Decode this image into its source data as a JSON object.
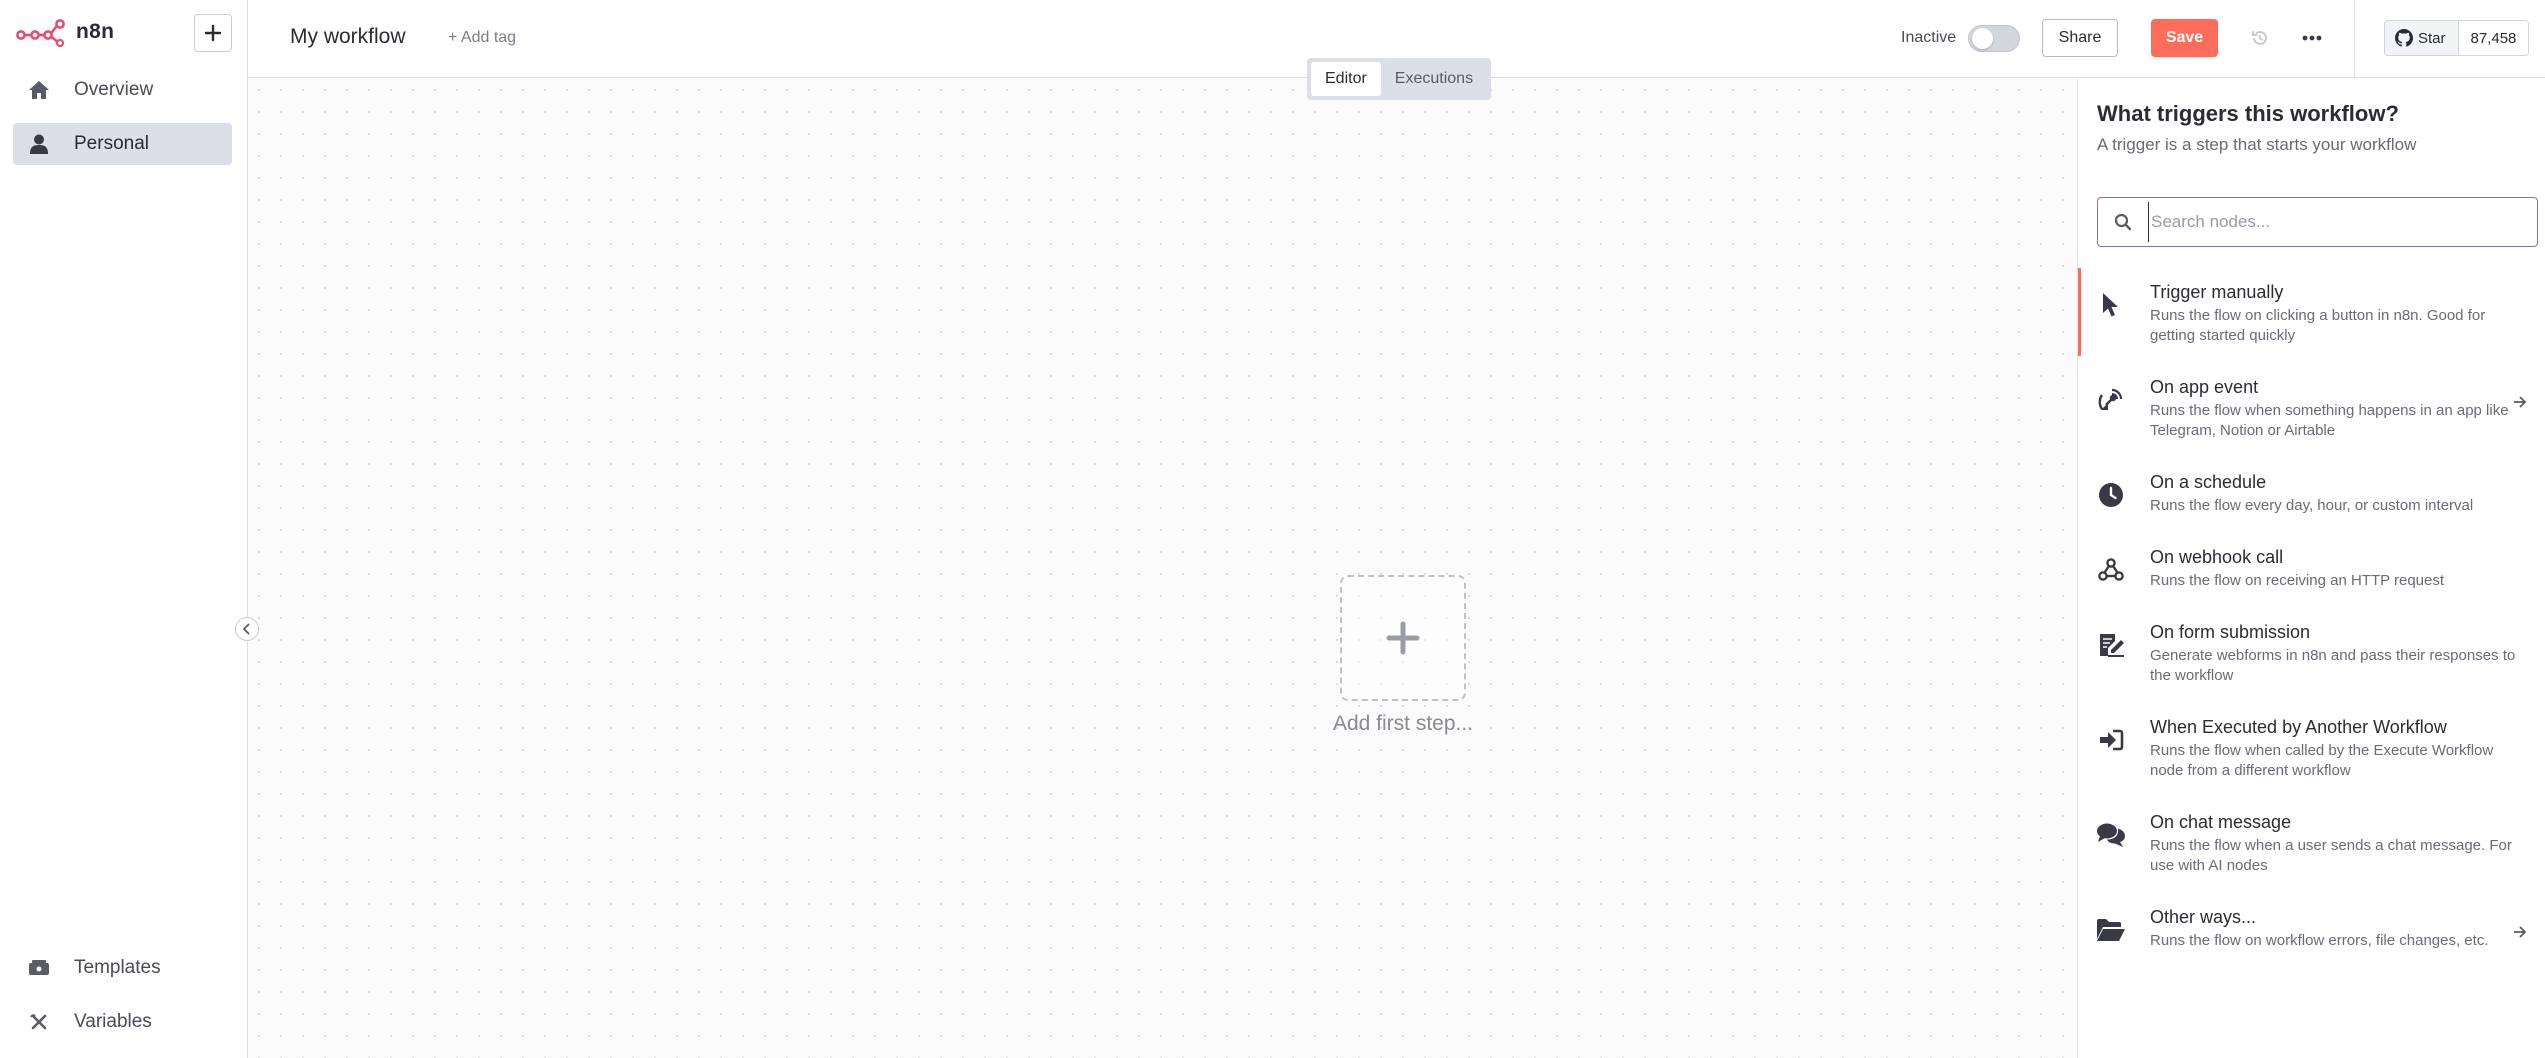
{
  "app": {
    "name": "n8n"
  },
  "sidebar": {
    "items": [
      {
        "label": "Overview",
        "icon": "home-icon",
        "active": false
      },
      {
        "label": "Personal",
        "icon": "user-icon",
        "active": true
      }
    ],
    "bottom_items": [
      {
        "label": "Templates",
        "icon": "templates-icon"
      },
      {
        "label": "Variables",
        "icon": "variables-icon"
      }
    ]
  },
  "header": {
    "workflow_name": "My workflow",
    "add_tag": "+ Add tag",
    "status": "Inactive",
    "share": "Share",
    "save": "Save",
    "github_star": "Star",
    "github_count": "87,458"
  },
  "canvas": {
    "tabs": [
      {
        "label": "Editor",
        "active": true
      },
      {
        "label": "Executions",
        "active": false
      }
    ],
    "add_first_step": "Add first step..."
  },
  "panel": {
    "title": "What triggers this workflow?",
    "subtitle": "A trigger is a step that starts your workflow",
    "search_placeholder": "Search nodes...",
    "triggers": [
      {
        "title": "Trigger manually",
        "desc": "Runs the flow on clicking a button in n8n. Good for getting started quickly",
        "icon": "cursor-icon",
        "arrow": false,
        "selected": true
      },
      {
        "title": "On app event",
        "desc": "Runs the flow when something happens in an app like Telegram, Notion or Airtable",
        "icon": "satellite-icon",
        "arrow": true
      },
      {
        "title": "On a schedule",
        "desc": "Runs the flow every day, hour, or custom interval",
        "icon": "clock-icon",
        "arrow": false
      },
      {
        "title": "On webhook call",
        "desc": "Runs the flow on receiving an HTTP request",
        "icon": "webhook-icon",
        "arrow": false
      },
      {
        "title": "On form submission",
        "desc": "Generate webforms in n8n and pass their responses to the workflow",
        "icon": "form-icon",
        "arrow": false
      },
      {
        "title": "When Executed by Another Workflow",
        "desc": "Runs the flow when called by the Execute Workflow node from a different workflow",
        "icon": "sign-in-icon",
        "arrow": false
      },
      {
        "title": "On chat message",
        "desc": "Runs the flow when a user sends a chat message. For use with AI nodes",
        "icon": "comments-icon",
        "arrow": false
      },
      {
        "title": "Other ways...",
        "desc": "Runs the flow on workflow errors, file changes, etc.",
        "icon": "folder-open-icon",
        "arrow": true
      }
    ]
  },
  "colors": {
    "accent": "#ff6d5a",
    "active_nav": "#dcdee8",
    "search_border": "#7b73c4"
  }
}
